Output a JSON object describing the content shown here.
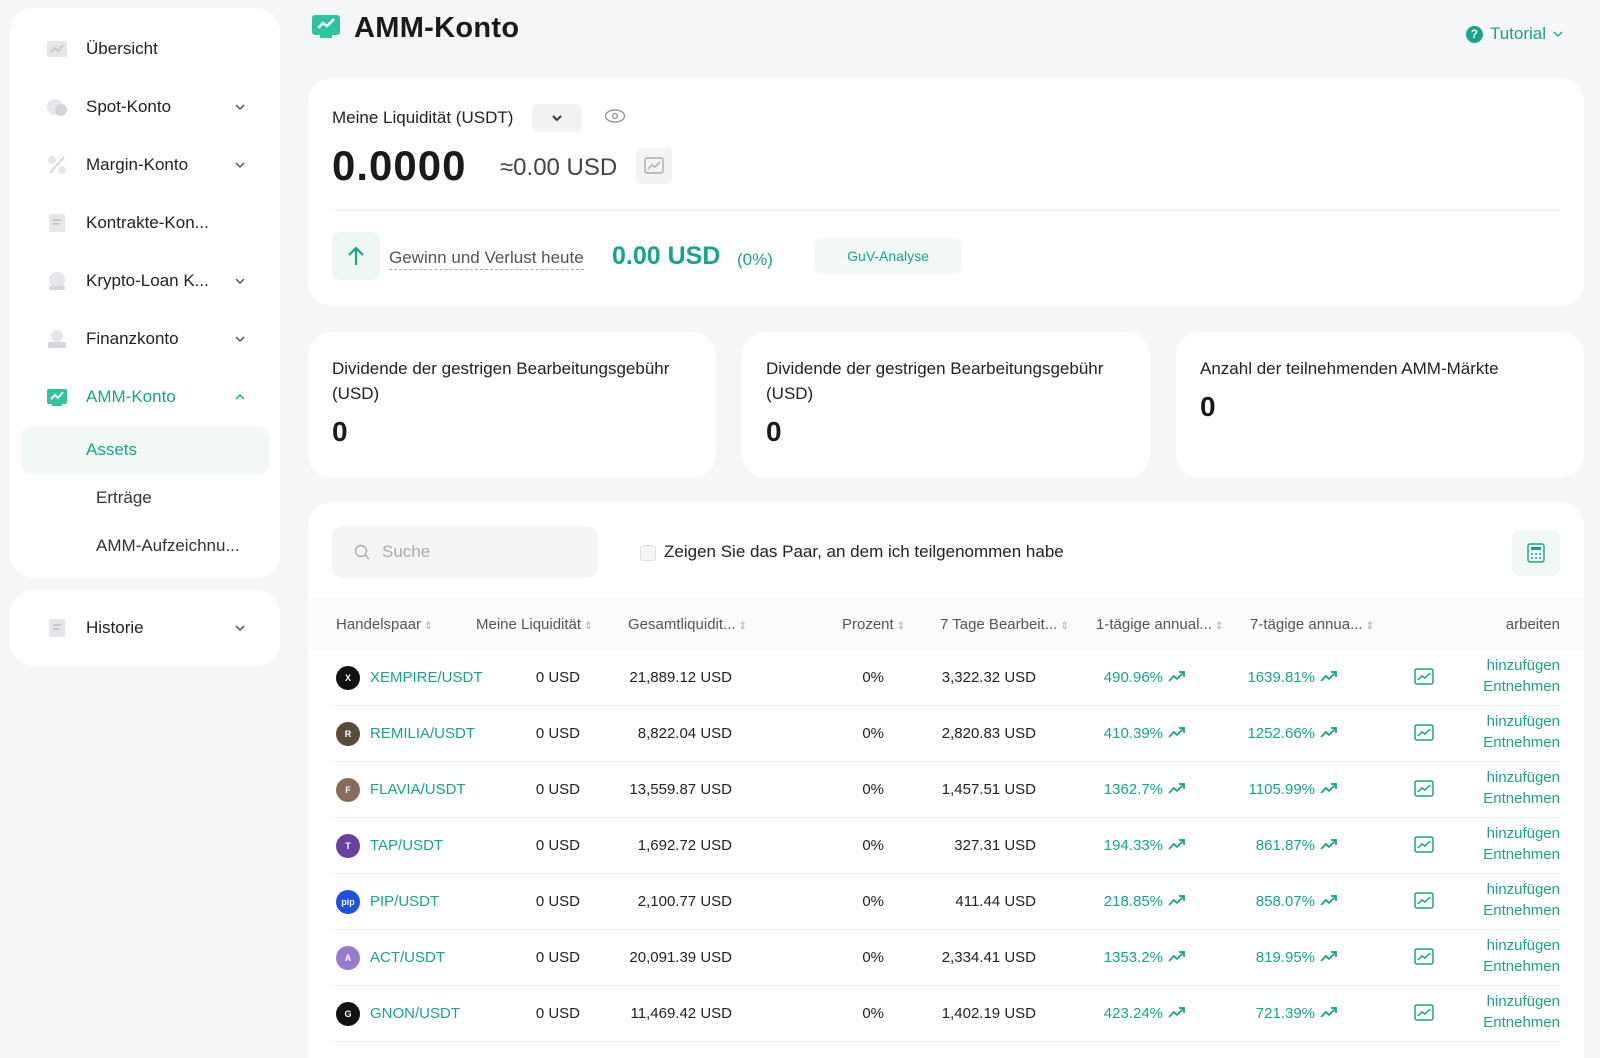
{
  "sidebar": {
    "items": [
      {
        "label": "Übersicht",
        "icon": "overview-icon"
      },
      {
        "label": "Spot-Konto",
        "icon": "spot-icon"
      },
      {
        "label": "Margin-Konto",
        "icon": "margin-icon"
      },
      {
        "label": "Kontrakte-Kon...",
        "icon": "contracts-icon"
      },
      {
        "label": "Krypto-Loan K...",
        "icon": "loan-icon"
      },
      {
        "label": "Finanzkonto",
        "icon": "finance-icon"
      },
      {
        "label": "AMM-Konto",
        "icon": "amm-icon"
      }
    ],
    "sub_items": [
      {
        "label": "Assets"
      },
      {
        "label": "Erträge"
      },
      {
        "label": "AMM-Aufzeichnu..."
      }
    ],
    "history": {
      "label": "Historie",
      "icon": "history-icon"
    }
  },
  "header": {
    "title": "AMM-Konto",
    "tutorial": "Tutorial"
  },
  "liquidity": {
    "label": "Meine Liquidität (USDT)",
    "value": "0.0000",
    "approx": "≈0.00 USD",
    "pnl_label": "Gewinn und Verlust heute",
    "pnl_value": "0.00 USD",
    "pnl_pct": "(0%)",
    "guv_button": "GuV-Analyse"
  },
  "stats": [
    {
      "label": "Dividende der gestrigen Bearbeitungsgebühr (USD)",
      "value": "0"
    },
    {
      "label": "Dividende der gestrigen Bearbeitungsgebühr (USD)",
      "value": "0"
    },
    {
      "label": "Anzahl der teilnehmenden AMM-Märkte",
      "value": "0"
    }
  ],
  "filter": {
    "search_placeholder": "Suche",
    "checkbox_label": "Zeigen Sie das Paar, an dem ich teilgenommen habe"
  },
  "table": {
    "columns": [
      "Handelspaar",
      "Meine Liquidität",
      "Gesamtliquidit...",
      "Prozent",
      "7 Tage Bearbeit...",
      "1-tägige annual...",
      "7-tägige annua...",
      "arbeiten"
    ],
    "add_label": "hinzufügen",
    "withdraw_label": "Entnehmen",
    "rows": [
      {
        "pair": "XEMPIRE/USDT",
        "coin_color": "#111111",
        "coin_text": "X",
        "my_liq": "0 USD",
        "total_liq": "21,889.12 USD",
        "pct": "0%",
        "fee7": "3,322.32 USD",
        "apy1": "490.96%",
        "apy7": "1639.81%"
      },
      {
        "pair": "REMILIA/USDT",
        "coin_color": "#5a4a3a",
        "coin_text": "R",
        "my_liq": "0 USD",
        "total_liq": "8,822.04 USD",
        "pct": "0%",
        "fee7": "2,820.83 USD",
        "apy1": "410.39%",
        "apy7": "1252.66%"
      },
      {
        "pair": "FLAVIA/USDT",
        "coin_color": "#8a6a5a",
        "coin_text": "F",
        "my_liq": "0 USD",
        "total_liq": "13,559.87 USD",
        "pct": "0%",
        "fee7": "1,457.51 USD",
        "apy1": "1362.7%",
        "apy7": "1105.99%"
      },
      {
        "pair": "TAP/USDT",
        "coin_color": "#6b3fa0",
        "coin_text": "T",
        "my_liq": "0 USD",
        "total_liq": "1,692.72 USD",
        "pct": "0%",
        "fee7": "327.31 USD",
        "apy1": "194.33%",
        "apy7": "861.87%"
      },
      {
        "pair": "PIP/USDT",
        "coin_color": "#1f4fe0",
        "coin_text": "pip",
        "my_liq": "0 USD",
        "total_liq": "2,100.77 USD",
        "pct": "0%",
        "fee7": "411.44 USD",
        "apy1": "218.85%",
        "apy7": "858.07%"
      },
      {
        "pair": "ACT/USDT",
        "coin_color": "#9a7ad0",
        "coin_text": "A",
        "my_liq": "0 USD",
        "total_liq": "20,091.39 USD",
        "pct": "0%",
        "fee7": "2,334.41 USD",
        "apy1": "1353.2%",
        "apy7": "819.95%"
      },
      {
        "pair": "GNON/USDT",
        "coin_color": "#111111",
        "coin_text": "G",
        "my_liq": "0 USD",
        "total_liq": "11,469.42 USD",
        "pct": "0%",
        "fee7": "1,402.19 USD",
        "apy1": "423.24%",
        "apy7": "721.39%"
      }
    ]
  },
  "colors": {
    "accent": "#17a589",
    "background": "#f5f6f8"
  }
}
